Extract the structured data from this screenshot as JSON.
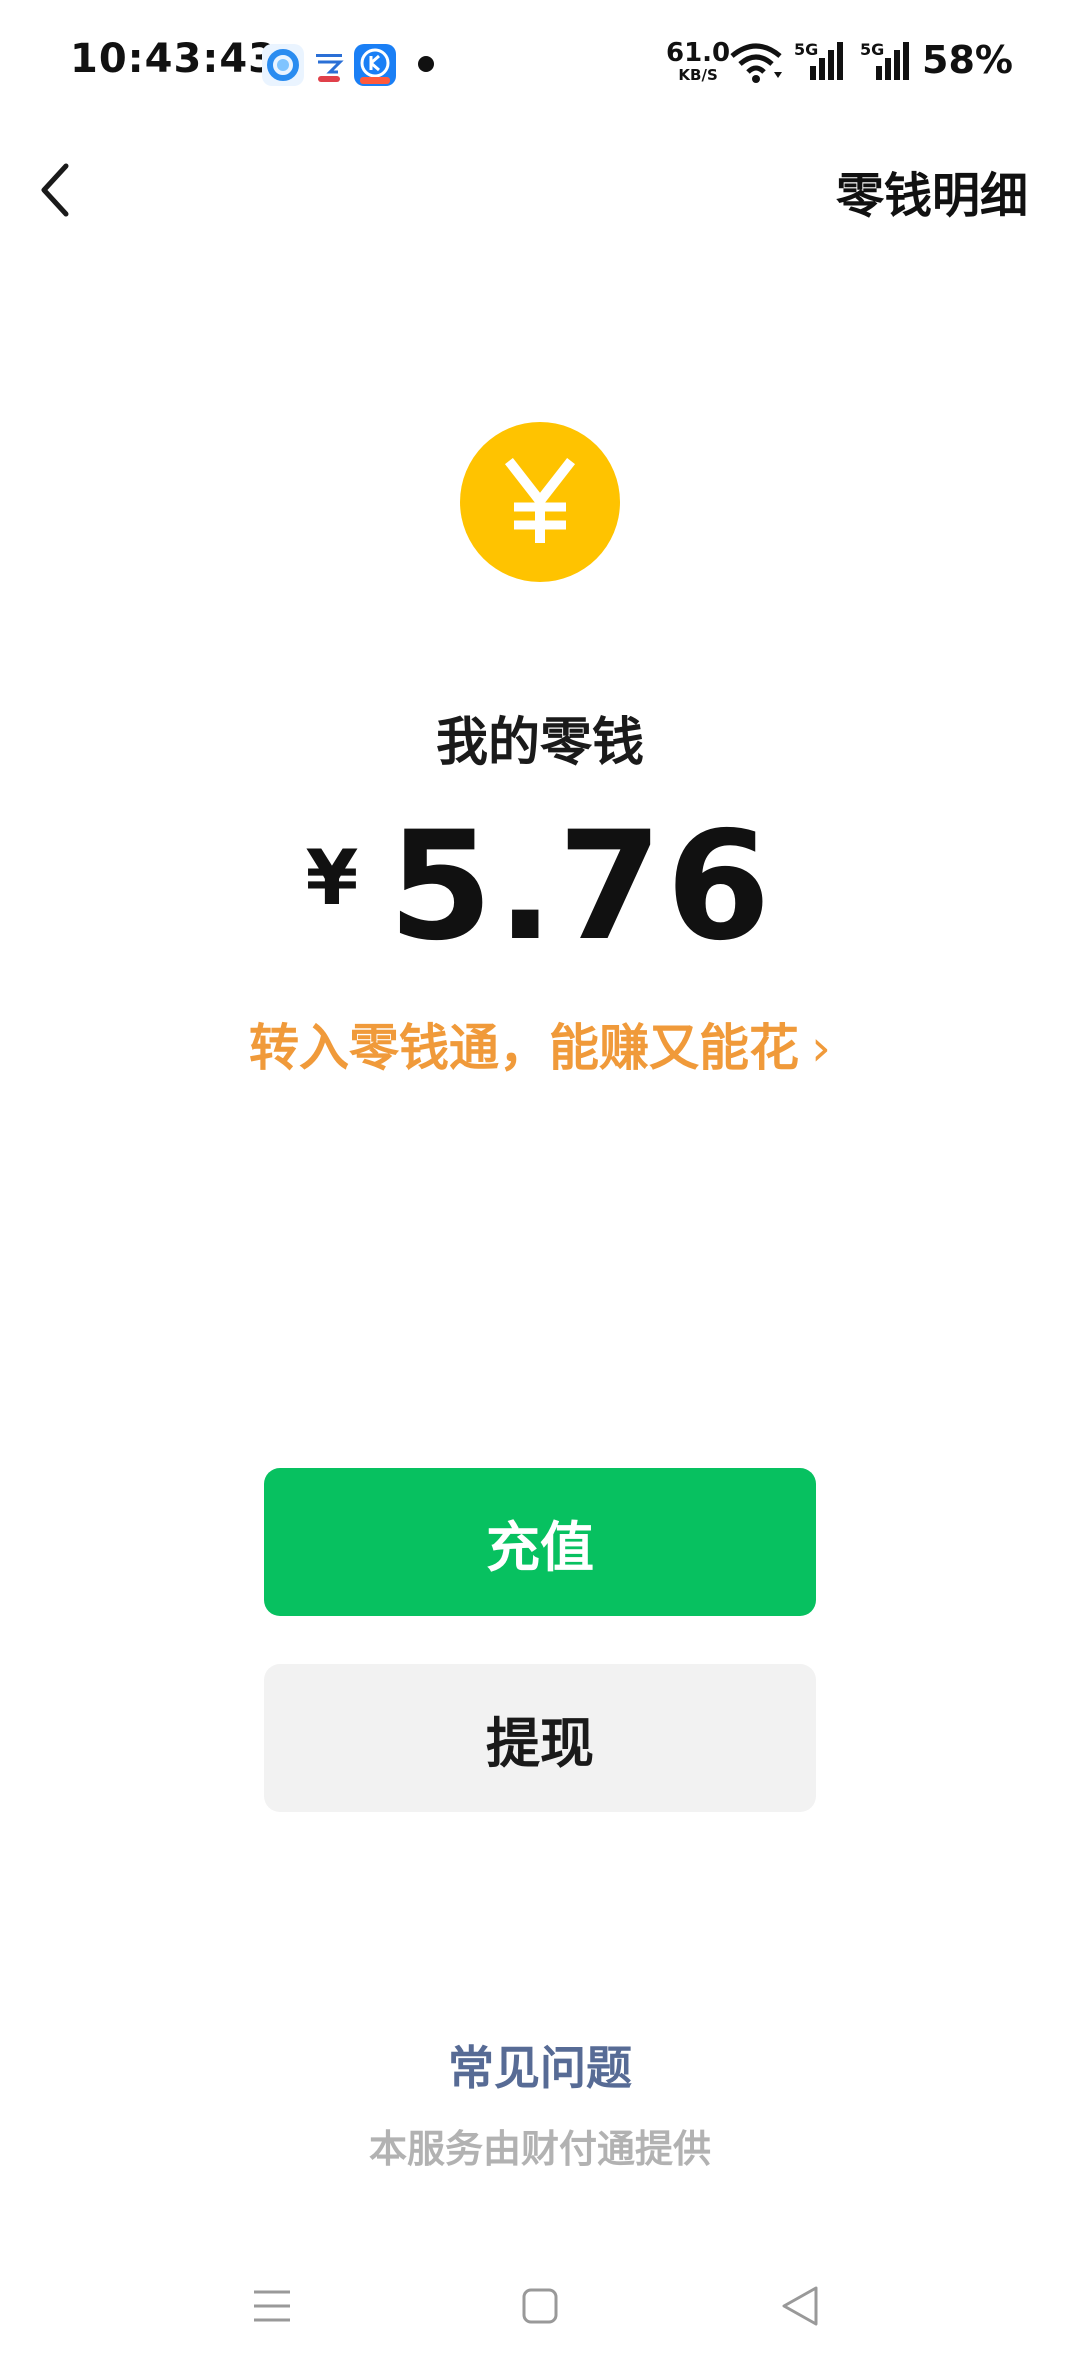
{
  "status_bar": {
    "time": "10:43:43",
    "net_speed_value": "61.0",
    "net_speed_unit": "KB/S",
    "signal_label_1": "5G",
    "signal_label_2": "5G",
    "battery": "58%",
    "notification_icons": [
      "qq-browser-icon",
      "cloud-app-icon",
      "kugou-icon"
    ]
  },
  "header": {
    "title": "零钱明细"
  },
  "wallet": {
    "label": "我的零钱",
    "currency_symbol": "¥",
    "balance": "5.76",
    "coin_symbol": "¥"
  },
  "promo": {
    "text": "转入零钱通，能赚又能花",
    "chevron": "›"
  },
  "actions": {
    "recharge": "充值",
    "withdraw": "提现"
  },
  "footer": {
    "faq": "常见问题",
    "provider": "本服务由财付通提供"
  },
  "colors": {
    "brand_green": "#07c160",
    "coin_yellow": "#ffc300",
    "promo_orange": "#f09a3a",
    "link_blue": "#576b95"
  }
}
